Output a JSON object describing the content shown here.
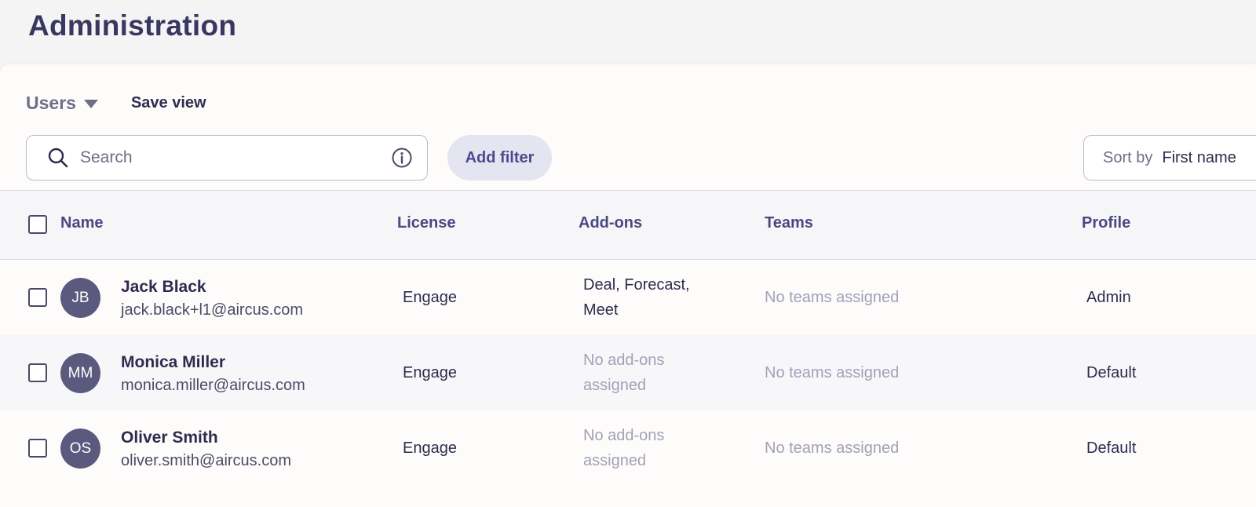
{
  "header": {
    "title": "Administration"
  },
  "toolbar": {
    "view_label": "Users",
    "save_view_label": "Save view",
    "search_placeholder": "Search",
    "add_filter_label": "Add filter",
    "sort_label": "Sort by",
    "sort_value": "First name"
  },
  "table": {
    "columns": [
      "Name",
      "License",
      "Add-ons",
      "Teams",
      "Profile"
    ],
    "rows": [
      {
        "initials": "JB",
        "name": "Jack Black",
        "email": "jack.black+l1@aircus.com",
        "license": "Engage",
        "addons": "Deal, Forecast, Meet",
        "addons_muted": false,
        "teams": "No teams assigned",
        "profile": "Admin"
      },
      {
        "initials": "MM",
        "name": "Monica Miller",
        "email": "monica.miller@aircus.com",
        "license": "Engage",
        "addons": "No add-ons assigned",
        "addons_muted": true,
        "teams": "No teams assigned",
        "profile": "Default"
      },
      {
        "initials": "OS",
        "name": "Oliver Smith",
        "email": "oliver.smith@aircus.com",
        "license": "Engage",
        "addons": "No add-ons assigned",
        "addons_muted": true,
        "teams": "No teams assigned",
        "profile": "Default"
      }
    ]
  },
  "icons": {
    "search": "search-icon",
    "info": "info-icon",
    "caret": "caret-down-icon"
  },
  "colors": {
    "accent": "#4c4a8e",
    "avatar": "#5b5a7e",
    "muted_text": "#a3a1b6"
  }
}
